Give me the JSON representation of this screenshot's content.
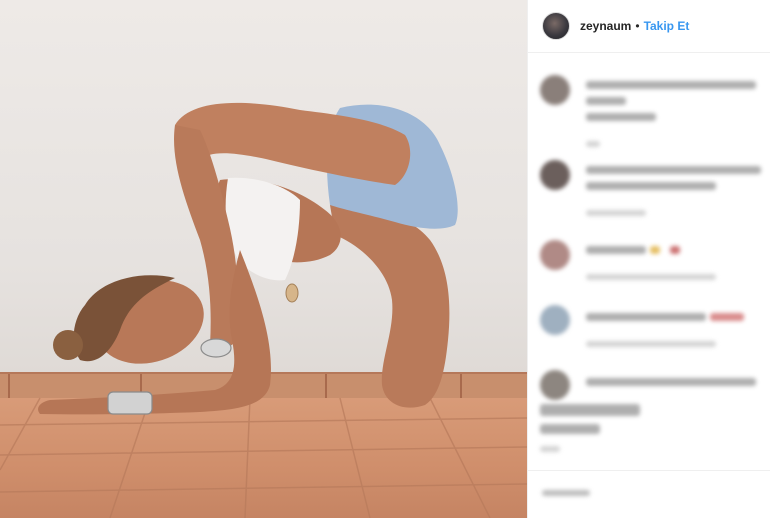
{
  "post": {
    "author": {
      "username": "zeynaum",
      "separator": "•",
      "follow_label": "Takip Et"
    },
    "photo": {
      "subject": "woman in yoga pose on terracotta tile floor"
    },
    "comments_blurred": true,
    "comments": [
      {
        "avatar_color": "#8a7f7a"
      },
      {
        "avatar_color": "#6b5f5c"
      },
      {
        "avatar_color": "#b08a86"
      },
      {
        "avatar_color": "#9fb0c0"
      },
      {
        "avatar_color": "#8d8680"
      }
    ],
    "colors": {
      "follow": "#3897f0",
      "username": "#262626"
    }
  }
}
